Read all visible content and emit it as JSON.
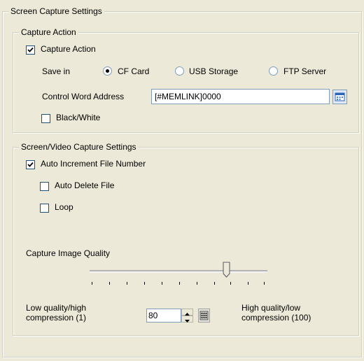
{
  "screen_capture_settings": {
    "title": "Screen Capture Settings",
    "capture_action_group": {
      "title": "Capture Action",
      "capture_action_checkbox": {
        "label": "Capture Action",
        "checked": true
      },
      "save_in": {
        "label": "Save in",
        "options": [
          {
            "label": "CF Card",
            "selected": true
          },
          {
            "label": "USB Storage",
            "selected": false
          },
          {
            "label": "FTP Server",
            "selected": false
          }
        ]
      },
      "control_word_address": {
        "label": "Control Word Address",
        "value": "[#MEMLINK]0000"
      },
      "black_white_checkbox": {
        "label": "Black/White",
        "checked": false
      }
    },
    "video_group": {
      "title": "Screen/Video Capture Settings",
      "auto_increment": {
        "label": "Auto Increment File Number",
        "checked": true
      },
      "auto_delete": {
        "label": "Auto Delete File",
        "checked": false
      },
      "loop": {
        "label": "Loop",
        "checked": false
      },
      "quality": {
        "label": "Capture Image Quality",
        "min": 1,
        "max": 100,
        "value": 80,
        "low_label_line1": "Low quality/high",
        "low_label_line2": "compression (1)",
        "high_label_line1": "High quality/low",
        "high_label_line2": "compression (100)",
        "value_text": "80"
      }
    }
  },
  "colors": {
    "background": "#ece9d8",
    "group_border": "#d0d0bf",
    "checkbox_border": "#1c5180",
    "input_border": "#7f9db9"
  },
  "icons": [
    "checkmark-icon",
    "calendar-picker-icon",
    "keypad-icon",
    "spin-up-icon",
    "spin-down-icon",
    "slider-thumb-icon"
  ]
}
